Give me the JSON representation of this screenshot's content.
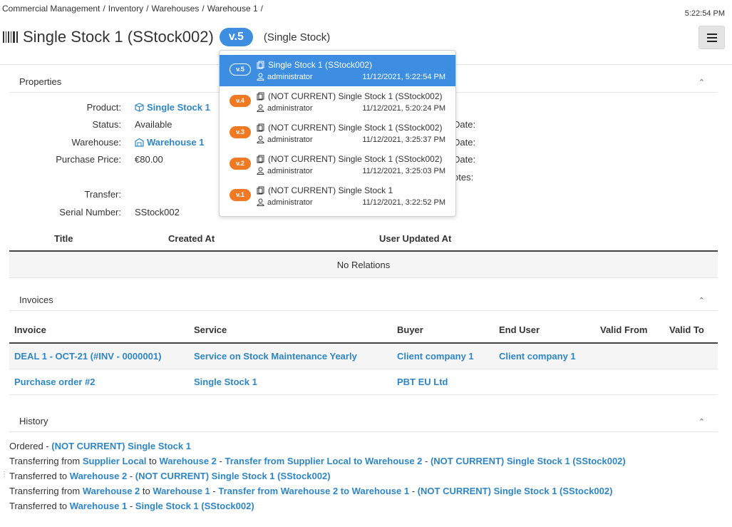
{
  "breadcrumb": [
    "Commercial Management",
    "Inventory",
    "Warehouses",
    "Warehouse 1"
  ],
  "clock": "5:22:54 PM",
  "header": {
    "title": "Single Stock 1 (SStock002)",
    "version": "v.5",
    "subtype": "(Single Stock)"
  },
  "colors": {
    "accent": "#3d8ee0",
    "link": "#2f86c6",
    "old_version": "#f07a24"
  },
  "properties": {
    "section_title": "Properties",
    "product_label": "Product:",
    "product_value": "Single Stock 1",
    "status_label": "Status:",
    "status_value": "Available",
    "warehouse_label": "Warehouse:",
    "warehouse_value": "Warehouse 1",
    "price_label": "Purchase Price:",
    "price_value": "€80.00",
    "transfer_label": "Transfer:",
    "serial_label": "Serial Number:",
    "serial_value": "SStock002",
    "right_labels": [
      "Date:",
      "Date:",
      "Date:",
      "otes:"
    ]
  },
  "relations": {
    "columns": [
      "Title",
      "Created At",
      "User Updated At"
    ],
    "empty_text": "No Relations"
  },
  "invoices": {
    "section_title": "Invoices",
    "columns": [
      "Invoice",
      "Service",
      "Buyer",
      "End User",
      "Valid From",
      "Valid To"
    ],
    "rows": [
      [
        "DEAL 1 - OCT-21 (#INV - 0000001)",
        "Service on Stock Maintenance Yearly",
        "Client company 1",
        "Client company 1",
        "",
        ""
      ],
      [
        "Purchase order #2",
        "Single Stock 1",
        "PBT EU Ltd",
        "",
        "",
        ""
      ]
    ]
  },
  "history": {
    "section_title": "History",
    "lines": [
      [
        [
          "Ordered - ",
          false
        ],
        [
          "(NOT CURRENT) Single Stock 1",
          true
        ]
      ],
      [
        [
          "Transferring from ",
          false
        ],
        [
          "Supplier Local",
          true
        ],
        [
          " to ",
          false
        ],
        [
          "Warehouse 2",
          true
        ],
        [
          " - ",
          false
        ],
        [
          "Transfer from Supplier Local to Warehouse 2",
          true
        ],
        [
          " - ",
          false
        ],
        [
          "(NOT CURRENT) Single Stock 1 (SStock002)",
          true
        ]
      ],
      [
        [
          "Transferred to ",
          false
        ],
        [
          "Warehouse 2",
          true
        ],
        [
          " - ",
          false
        ],
        [
          "(NOT CURRENT) Single Stock 1 (SStock002)",
          true
        ]
      ],
      [
        [
          "Transferring from ",
          false
        ],
        [
          "Warehouse 2",
          true
        ],
        [
          " to ",
          false
        ],
        [
          "Warehouse 1",
          true
        ],
        [
          " - ",
          false
        ],
        [
          "Transfer from Warehouse 2 to Warehouse 1",
          true
        ],
        [
          " - ",
          false
        ],
        [
          "(NOT CURRENT) Single Stock 1 (SStock002)",
          true
        ]
      ],
      [
        [
          "Transferred to ",
          false
        ],
        [
          "Warehouse 1",
          true
        ],
        [
          " - ",
          false
        ],
        [
          "Single Stock 1 (SStock002)",
          true
        ]
      ]
    ]
  },
  "versions": [
    {
      "badge": "v.5",
      "title": "Single Stock 1 (SStock002)",
      "user": "administrator",
      "date": "11/12/2021, 5:22:54 PM",
      "active": true
    },
    {
      "badge": "v.4",
      "title": "(NOT CURRENT) Single Stock 1 (SStock002)",
      "user": "administrator",
      "date": "11/12/2021, 5:20:24 PM",
      "active": false
    },
    {
      "badge": "v.3",
      "title": "(NOT CURRENT) Single Stock 1 (SStock002)",
      "user": "administrator",
      "date": "11/12/2021, 3:25:37 PM",
      "active": false
    },
    {
      "badge": "v.2",
      "title": "(NOT CURRENT) Single Stock 1 (SStock002)",
      "user": "administrator",
      "date": "11/12/2021, 3:25:03 PM",
      "active": false
    },
    {
      "badge": "v.1",
      "title": "(NOT CURRENT) Single Stock 1",
      "user": "administrator",
      "date": "11/12/2021, 3:22:52 PM",
      "active": false
    }
  ]
}
